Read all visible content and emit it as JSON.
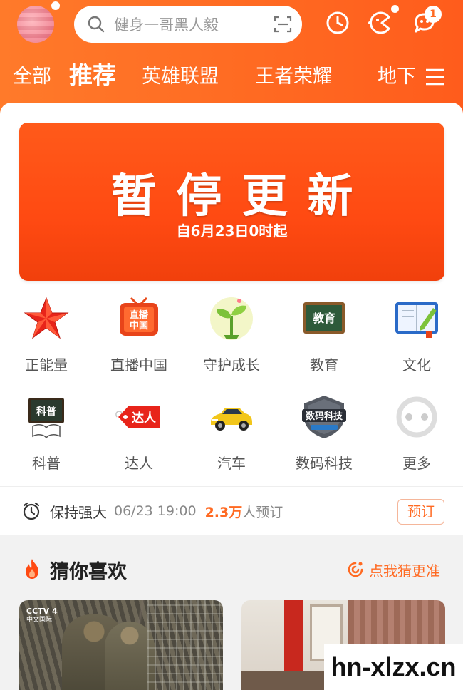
{
  "header": {
    "search_placeholder": "健身一哥黑人毅",
    "notification_count": "1",
    "tabs": [
      {
        "label": "全部",
        "active": false
      },
      {
        "label": "推荐",
        "active": true
      },
      {
        "label": "英雄联盟",
        "active": false
      },
      {
        "label": "王者荣耀",
        "active": false
      },
      {
        "label": "地下",
        "active": false
      }
    ]
  },
  "banner": {
    "title": "暂停更新",
    "subtitle": "自6月23日0时起"
  },
  "categories": [
    {
      "label": "正能量",
      "icon": "red-star-icon"
    },
    {
      "label": "直播中国",
      "icon": "tv-live-china-icon"
    },
    {
      "label": "守护成长",
      "icon": "sprout-icon"
    },
    {
      "label": "教育",
      "icon": "blackboard-icon"
    },
    {
      "label": "文化",
      "icon": "book-pen-icon"
    },
    {
      "label": "科普",
      "icon": "science-board-icon"
    },
    {
      "label": "达人",
      "icon": "expert-tag-icon"
    },
    {
      "label": "汽车",
      "icon": "car-icon"
    },
    {
      "label": "数码科技",
      "icon": "tech-badge-icon"
    },
    {
      "label": "更多",
      "icon": "more-icon"
    }
  ],
  "reservation": {
    "title": "保持强大",
    "time": "06/23 19:00",
    "count": "2.3万",
    "count_suffix": "人预订",
    "button": "预订"
  },
  "guess": {
    "title": "猜你喜欢",
    "link": "点我猜更准"
  },
  "video_thumbs": [
    {
      "channel_logo": "CCTV 4",
      "channel_sub": "中文国际"
    },
    {}
  ],
  "watermark": "hn-xlzx.cn",
  "colors": {
    "brand_orange": "#ff6a22",
    "banner_red": "#ff4a12"
  }
}
